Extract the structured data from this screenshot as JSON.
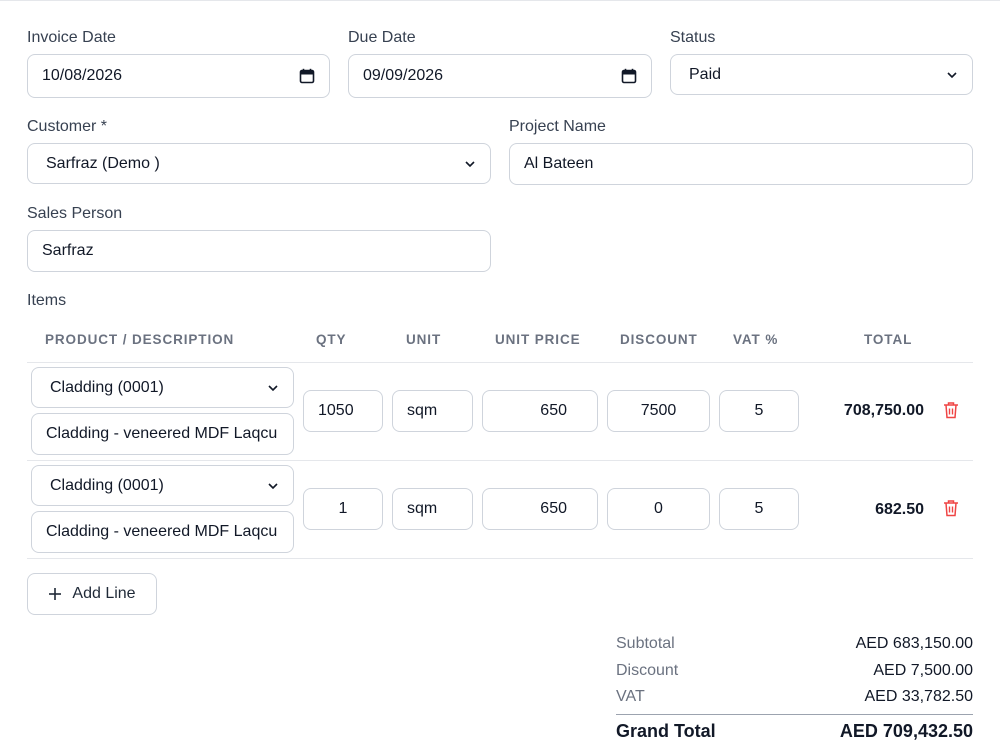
{
  "form": {
    "invoice_date": {
      "label": "Invoice Date",
      "value": "10/08/2026"
    },
    "due_date": {
      "label": "Due Date",
      "value": "09/09/2026"
    },
    "status": {
      "label": "Status",
      "value": "Paid"
    },
    "customer": {
      "label": "Customer *",
      "value": "Sarfraz (Demo )"
    },
    "project_name": {
      "label": "Project Name",
      "value": "Al Bateen"
    },
    "sales_person": {
      "label": "Sales Person",
      "value": "Sarfraz"
    }
  },
  "items": {
    "heading": "Items",
    "columns": [
      "PRODUCT / DESCRIPTION",
      "QTY",
      "UNIT",
      "UNIT PRICE",
      "DISCOUNT",
      "VAT %",
      "TOTAL"
    ],
    "rows": [
      {
        "product": "Cladding (0001)",
        "description": "Cladding - veneered MDF Laqcu",
        "qty": "1050",
        "unit": "sqm",
        "unit_price": "650",
        "discount": "7500",
        "vat": "5",
        "total": "708,750.00"
      },
      {
        "product": "Cladding (0001)",
        "description": "Cladding - veneered MDF Laqcu",
        "qty": "1",
        "unit": "sqm",
        "unit_price": "650",
        "discount": "0",
        "vat": "5",
        "total": "682.50"
      }
    ],
    "add_line_label": "Add Line"
  },
  "summary": {
    "subtotal_label": "Subtotal",
    "subtotal": "AED 683,150.00",
    "discount_label": "Discount",
    "discount": "AED 7,500.00",
    "vat_label": "VAT",
    "vat": "AED 33,782.50",
    "grand_total_label": "Grand Total",
    "grand_total": "AED 709,432.50"
  },
  "colors": {
    "delete": "#ef4444",
    "border": "#cfd4dc",
    "muted": "#6b7280"
  },
  "icons": {
    "date": "calendar-icon",
    "select": "chevron-down-icon",
    "delete": "trash-icon",
    "add": "plus-icon"
  }
}
